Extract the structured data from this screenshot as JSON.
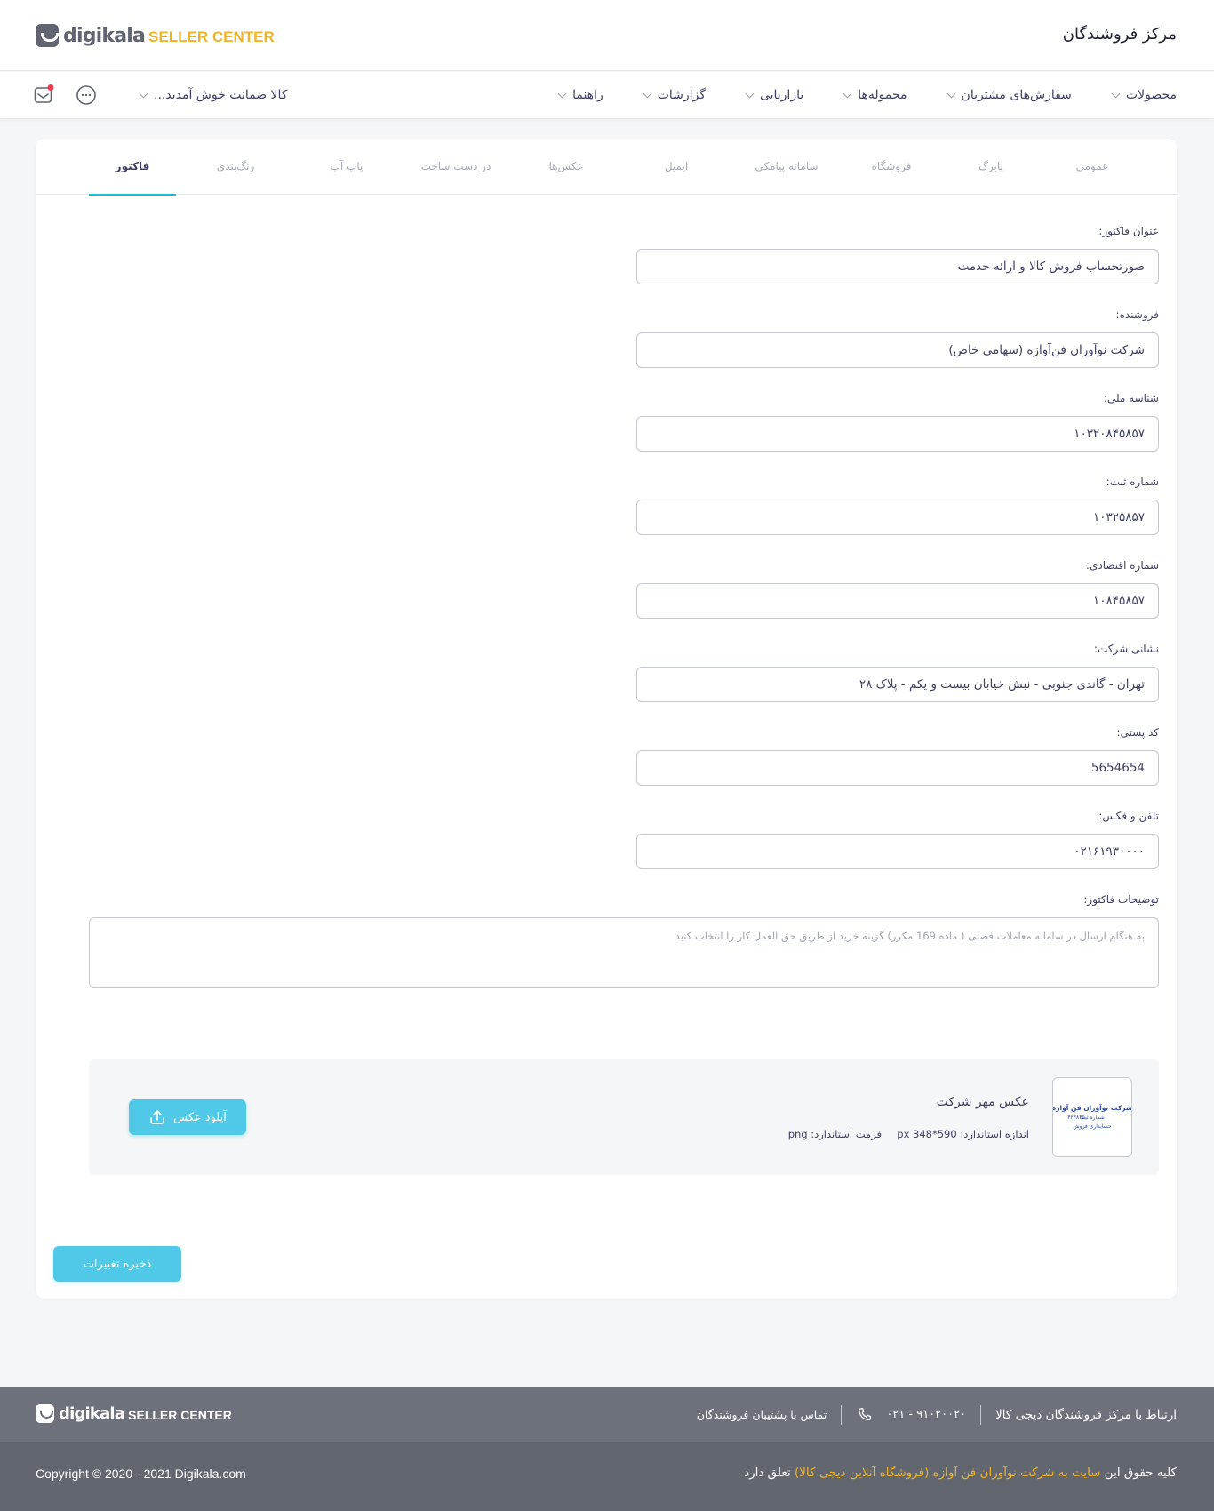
{
  "header": {
    "logo_word": "digikala",
    "logo_sub": "SELLER CENTER",
    "site_title": "مرکز فروشندگان"
  },
  "nav": {
    "items": [
      {
        "label": "محصولات"
      },
      {
        "label": "سفارش‌های مشتریان"
      },
      {
        "label": "محموله‌ها"
      },
      {
        "label": "بازاریابی"
      },
      {
        "label": "گزارشات"
      },
      {
        "label": "راهنما"
      }
    ],
    "user_menu_label": "کالا ضمانت خوش آمدید..."
  },
  "tabs": [
    {
      "label": "عمومی",
      "active": false
    },
    {
      "label": "پابرگ",
      "active": false
    },
    {
      "label": "فروشگاه",
      "active": false
    },
    {
      "label": "سامانه پیامکی",
      "active": false
    },
    {
      "label": "ایمیل",
      "active": false
    },
    {
      "label": "عکس‌ها",
      "active": false
    },
    {
      "label": "در دست ساخت",
      "active": false
    },
    {
      "label": "پاپ آپ",
      "active": false
    },
    {
      "label": "رنگ‌بندی",
      "active": false
    },
    {
      "label": "فاکتور",
      "active": true
    }
  ],
  "form": {
    "fields": [
      {
        "label": "عنوان فاکتور:",
        "value": "صورتحساب فروش کالا و ارائه خدمت"
      },
      {
        "label": "فروشنده:",
        "value": "شرکت نوآوران فن‌آوازه (سهامی خاص)"
      },
      {
        "label": "شناسه ملی:",
        "value": "۱۰۳۲۰۸۴۵۸۵۷"
      },
      {
        "label": "شماره ثبت:",
        "value": "۱۰۳۲۵۸۵۷"
      },
      {
        "label": "شماره اقتصادی:",
        "value": "۱۰۸۴۵۸۵۷"
      },
      {
        "label": "نشانی شرکت:",
        "value": "تهران - گاندی جنوبی - نبش خیابان بیست و یکم - پلاک ۲۸"
      },
      {
        "label": "کد پستی:",
        "value": "5654654"
      },
      {
        "label": "تلفن و فکس:",
        "value": "۰۲۱۶۱۹۳۰۰۰۰"
      }
    ],
    "notes_label": "توضیحات فاکتور:",
    "notes_placeholder": "به هنگام ارسال در سامانه معاملات فصلی ( ماده 169 مکرر) گزینه خرید از طریق حق العمل کار را انتخاب کنید"
  },
  "stamp": {
    "title": "عکس مهر شرکت",
    "size_text": "اندازه استاندارد: 590*348 px",
    "format_text": "فرمت استاندارد: png",
    "stamp_line1": "شرکت نوآوران فن آوازه",
    "stamp_line2": "شماره ثبت",
    "stamp_line3": "۴۲۳۸۴۵",
    "stamp_line4": "حسابداری فروش",
    "upload_label": "آپلود عکس",
    "upload_icon": "upload-icon"
  },
  "save_label": "ذخیره تغییرات",
  "footer": {
    "contact_title": "ارتباط با مرکز فروشندگان دیجی کالا",
    "phone": "۰۲۱ - ۹۱۰۲۰۰۲۰",
    "support_label": "تماس با پشتیبان فروشندگان",
    "logo_word": "digikala",
    "logo_sub": "SELLER CENTER",
    "copyright_pre": "کلیه حقوق این",
    "copyright_highlight": "سایت به شرکت نوآوران فن آوازه (فروشگاه آنلاین دیجی کالا)",
    "copyright_post": "تعلق دارد",
    "copyright_en": "Copyright © 2020 - 2021 Digikala.com"
  },
  "colors": {
    "accent": "#19bfd3",
    "button": "#4fc9e7",
    "brand_yellow": "#f0b429",
    "notification_dot": "#ef394e"
  }
}
